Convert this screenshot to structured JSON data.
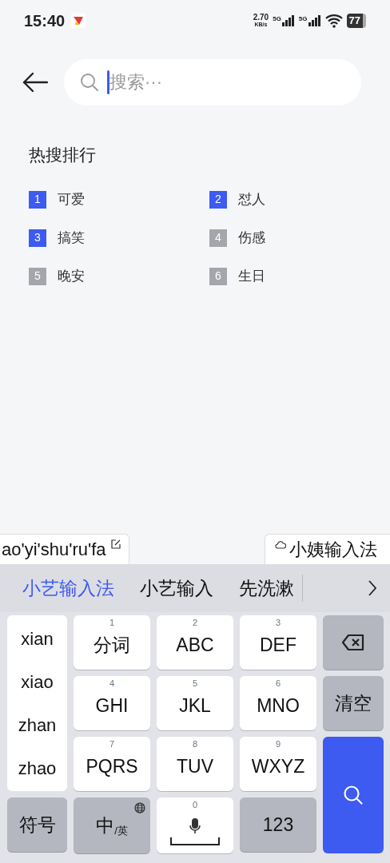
{
  "status_bar": {
    "time": "15:40",
    "net_speed": "2.70",
    "net_unit": "KB/s",
    "signals": [
      "5G",
      "5G"
    ],
    "battery": "77"
  },
  "search": {
    "placeholder": "搜索···"
  },
  "hot_search": {
    "title": "热搜排行",
    "items": [
      {
        "rank": "1",
        "label": "可爱",
        "color": "#3d5af1"
      },
      {
        "rank": "2",
        "label": "怼人",
        "color": "#3d5af1"
      },
      {
        "rank": "3",
        "label": "搞笑",
        "color": "#3d5af1"
      },
      {
        "rank": "4",
        "label": "伤感",
        "color": "#a4a6ab"
      },
      {
        "rank": "5",
        "label": "晚安",
        "color": "#a4a6ab"
      },
      {
        "rank": "6",
        "label": "生日",
        "color": "#a4a6ab"
      }
    ]
  },
  "composing": {
    "pinyin": "ao'yi'shu'ru'fa",
    "cloud_candidate": "小姨输入法"
  },
  "candidates": [
    {
      "text": "小艺输入法",
      "selected": true
    },
    {
      "text": "小艺输入",
      "selected": false
    },
    {
      "text": "先洗漱",
      "selected": false
    }
  ],
  "keyboard": {
    "pinyin_options": [
      "xian",
      "xiao",
      "zhan",
      "zhao"
    ],
    "keys": [
      {
        "kind": "t9",
        "digit": "1",
        "label": "分词"
      },
      {
        "kind": "t9",
        "digit": "2",
        "label": "ABC"
      },
      {
        "kind": "t9",
        "digit": "3",
        "label": "DEF"
      },
      {
        "kind": "backspace"
      },
      {
        "kind": "t9",
        "digit": "4",
        "label": "GHI"
      },
      {
        "kind": "t9",
        "digit": "5",
        "label": "JKL"
      },
      {
        "kind": "t9",
        "digit": "6",
        "label": "MNO"
      },
      {
        "kind": "function",
        "label": "清空"
      },
      {
        "kind": "t9",
        "digit": "7",
        "label": "PQRS"
      },
      {
        "kind": "t9",
        "digit": "8",
        "label": "TUV"
      },
      {
        "kind": "t9",
        "digit": "9",
        "label": "WXYZ"
      },
      {
        "kind": "search"
      },
      {
        "kind": "function",
        "label": "符号"
      },
      {
        "kind": "lang",
        "label": "中$_{/英}$"
      },
      {
        "kind": "space",
        "digit": "0"
      },
      {
        "kind": "function",
        "label": "123"
      }
    ]
  }
}
